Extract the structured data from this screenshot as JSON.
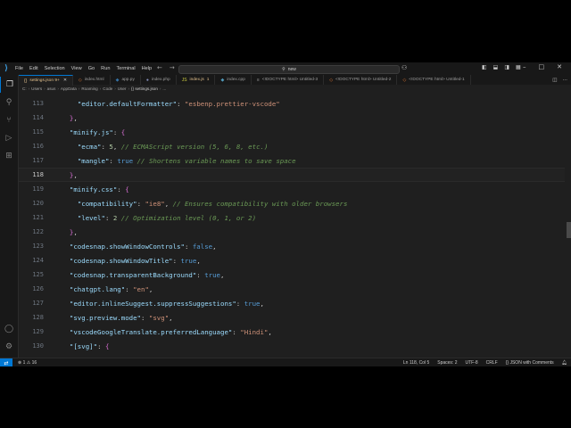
{
  "menu": [
    "File",
    "Edit",
    "Selection",
    "View",
    "Go",
    "Run",
    "Terminal",
    "Help"
  ],
  "search": {
    "text": "new",
    "icon": "search-icon"
  },
  "tabs": [
    {
      "label": "settings.json 9+",
      "modified": "",
      "active": true
    },
    {
      "label": "index.html",
      "modified": "",
      "active": false
    },
    {
      "label": "app.py",
      "modified": "",
      "active": false
    },
    {
      "label": "index.php",
      "modified": "",
      "active": false
    },
    {
      "label": "index.js",
      "modified": "1",
      "active": false
    },
    {
      "label": "index.cpp",
      "modified": "",
      "active": false
    },
    {
      "label": "<!DOCTYPE html> Untitled-3",
      "modified": "",
      "active": false
    },
    {
      "label": "<!DOCTYPE html> Untitled-2",
      "modified": "",
      "active": false
    },
    {
      "label": "<!DOCTYPE html> Untitled-1",
      "modified": "",
      "active": false
    }
  ],
  "breadcrumb": [
    "C:",
    "Users",
    "asus",
    "AppData",
    "Roaming",
    "Code",
    "User",
    "{} settings.json",
    "..."
  ],
  "lines": [
    {
      "n": "113",
      "tokens": [
        [
          "p",
          "    "
        ],
        [
          "k",
          "\"editor.defaultFormatter\""
        ],
        [
          "p",
          ": "
        ],
        [
          "s",
          "\"esbenp.prettier-vscode\""
        ]
      ]
    },
    {
      "n": "114",
      "tokens": [
        [
          "p",
          "  "
        ],
        [
          "br2",
          "}"
        ],
        [
          "p",
          ","
        ]
      ]
    },
    {
      "n": "115",
      "tokens": [
        [
          "p",
          "  "
        ],
        [
          "k",
          "\"minify.js\""
        ],
        [
          "p",
          ": "
        ],
        [
          "br2",
          "{"
        ]
      ]
    },
    {
      "n": "116",
      "tokens": [
        [
          "p",
          "    "
        ],
        [
          "k",
          "\"ecma\""
        ],
        [
          "p",
          ": "
        ],
        [
          "n",
          "5"
        ],
        [
          "p",
          ", "
        ],
        [
          "c",
          "// ECMAScript version (5, 6, 8, etc.)"
        ]
      ]
    },
    {
      "n": "117",
      "tokens": [
        [
          "p",
          "    "
        ],
        [
          "k",
          "\"mangle\""
        ],
        [
          "p",
          ": "
        ],
        [
          "b",
          "true"
        ],
        [
          "p",
          " "
        ],
        [
          "c",
          "// Shortens variable names to save space"
        ]
      ]
    },
    {
      "n": "118",
      "tokens": [
        [
          "p",
          "  "
        ],
        [
          "br2",
          "}"
        ],
        [
          "p",
          ","
        ]
      ],
      "current": true
    },
    {
      "n": "119",
      "tokens": [
        [
          "p",
          "  "
        ],
        [
          "k",
          "\"minify.css\""
        ],
        [
          "p",
          ": "
        ],
        [
          "br2",
          "{"
        ]
      ]
    },
    {
      "n": "120",
      "tokens": [
        [
          "p",
          "    "
        ],
        [
          "k",
          "\"compatibility\""
        ],
        [
          "p",
          ": "
        ],
        [
          "s",
          "\"ie8\""
        ],
        [
          "p",
          ", "
        ],
        [
          "c",
          "// Ensures compatibility with older browsers"
        ]
      ]
    },
    {
      "n": "121",
      "tokens": [
        [
          "p",
          "    "
        ],
        [
          "k",
          "\"level\""
        ],
        [
          "p",
          ": "
        ],
        [
          "n",
          "2"
        ],
        [
          "p",
          " "
        ],
        [
          "c",
          "// Optimization level (0, 1, or 2)"
        ]
      ]
    },
    {
      "n": "122",
      "tokens": [
        [
          "p",
          "  "
        ],
        [
          "br2",
          "}"
        ],
        [
          "p",
          ","
        ]
      ]
    },
    {
      "n": "123",
      "tokens": [
        [
          "p",
          "  "
        ],
        [
          "k",
          "\"codesnap.showWindowControls\""
        ],
        [
          "p",
          ": "
        ],
        [
          "b",
          "false"
        ],
        [
          "p",
          ","
        ]
      ]
    },
    {
      "n": "124",
      "tokens": [
        [
          "p",
          "  "
        ],
        [
          "k",
          "\"codesnap.showWindowTitle\""
        ],
        [
          "p",
          ": "
        ],
        [
          "b",
          "true"
        ],
        [
          "p",
          ","
        ]
      ]
    },
    {
      "n": "125",
      "tokens": [
        [
          "p",
          "  "
        ],
        [
          "k",
          "\"codesnap.transparentBackground\""
        ],
        [
          "p",
          ": "
        ],
        [
          "b",
          "true"
        ],
        [
          "p",
          ","
        ]
      ]
    },
    {
      "n": "126",
      "tokens": [
        [
          "p",
          "  "
        ],
        [
          "k",
          "\"chatgpt.lang\""
        ],
        [
          "p",
          ": "
        ],
        [
          "s",
          "\"en\""
        ],
        [
          "p",
          ","
        ]
      ]
    },
    {
      "n": "127",
      "tokens": [
        [
          "p",
          "  "
        ],
        [
          "k",
          "\"editor.inlineSuggest.suppressSuggestions\""
        ],
        [
          "p",
          ": "
        ],
        [
          "b",
          "true"
        ],
        [
          "p",
          ","
        ]
      ]
    },
    {
      "n": "128",
      "tokens": [
        [
          "p",
          "  "
        ],
        [
          "k",
          "\"svg.preview.mode\""
        ],
        [
          "p",
          ": "
        ],
        [
          "s",
          "\"svg\""
        ],
        [
          "p",
          ","
        ]
      ]
    },
    {
      "n": "129",
      "tokens": [
        [
          "p",
          "  "
        ],
        [
          "k",
          "\"vscodeGoogleTranslate.preferredLanguage\""
        ],
        [
          "p",
          ": "
        ],
        [
          "s",
          "\"Hindi\""
        ],
        [
          "p",
          ","
        ]
      ]
    },
    {
      "n": "130",
      "tokens": [
        [
          "p",
          "  "
        ],
        [
          "k",
          "\"[svg]\""
        ],
        [
          "p",
          ": "
        ],
        [
          "br2",
          "{"
        ]
      ]
    }
  ],
  "status": {
    "problems": "⊗ 1 ⚠ 16",
    "position": "Ln 118, Col 5",
    "spaces": "Spaces: 2",
    "encoding": "UTF-8",
    "eol": "CRLF",
    "language": "{} JSON with Comments"
  }
}
